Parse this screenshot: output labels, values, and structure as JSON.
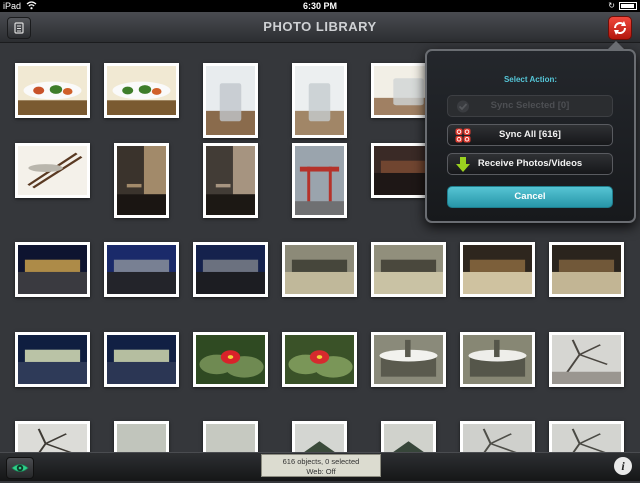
{
  "status_bar": {
    "device": "iPad",
    "time": "6:30 PM",
    "battery_level": 0.9
  },
  "nav": {
    "title": "PHOTO LIBRARY"
  },
  "popover": {
    "heading": "Select Action:",
    "sync_selected": "Sync Selected [0]",
    "sync_all": "Sync All [616]",
    "receive": "Receive Photos/Videos",
    "cancel": "Cancel"
  },
  "toolbar": {
    "status_line1": "616 objects, 0 selected",
    "status_line2": "Web: Off"
  },
  "icons": [
    "album-icon",
    "sync-icon",
    "checkmark-icon",
    "sync-arrows-icon",
    "download-arrow-icon",
    "eye-icon",
    "info-icon"
  ],
  "colors": {
    "accent": "#3bb0c2",
    "sync_red": "#e0281c",
    "heading_cyan": "#55c6d8"
  },
  "photos": [
    {
      "subject": "plate-dish",
      "colors": [
        "#f1e9d3",
        "#7a5a31",
        "#c8522a"
      ]
    },
    {
      "subject": "plate-dish",
      "colors": [
        "#f1e9d3",
        "#7a5a31",
        "#3e7d2a"
      ]
    },
    {
      "subject": "glass",
      "colors": [
        "#e8ecee",
        "#8a6b4c",
        "#c0c7cc"
      ]
    },
    {
      "subject": "glass",
      "colors": [
        "#eceff0",
        "#a18667",
        "#c6ccd0"
      ]
    },
    {
      "subject": "glass",
      "colors": [
        "#f2efe6",
        "#a08063",
        "#d0d4d6"
      ]
    },
    {
      "subject": "chopsticks",
      "colors": [
        "#f4f1ea",
        "#5a3a23",
        "#b9b6ad"
      ]
    },
    {
      "subject": "interior",
      "colors": [
        "#3a332c",
        "#1a1512",
        "#a28a6a"
      ]
    },
    {
      "subject": "interior",
      "colors": [
        "#423c36",
        "#1c1814",
        "#a69480"
      ]
    },
    {
      "subject": "torii-building",
      "colors": [
        "#9aa4ad",
        "#b5322a",
        "#6f7072"
      ]
    },
    {
      "subject": "night-street",
      "colors": [
        "#3a2a26",
        "#7a4a32",
        "#1e1716"
      ]
    },
    {
      "subject": "night-city",
      "colors": [
        "#0e1430",
        "#c9a04c",
        "#3a3a40"
      ]
    },
    {
      "subject": "night-city",
      "colors": [
        "#1a2a6a",
        "#8a8f9a",
        "#23242a"
      ]
    },
    {
      "subject": "night-city",
      "colors": [
        "#15224d",
        "#7a7f88",
        "#1c1d22"
      ]
    },
    {
      "subject": "plaza-night",
      "colors": [
        "#8c8a78",
        "#3a3a30",
        "#c0b89a"
      ]
    },
    {
      "subject": "plaza-night",
      "colors": [
        "#918f7c",
        "#3d3c33",
        "#c9c2a4"
      ]
    },
    {
      "subject": "night-traffic",
      "colors": [
        "#2e261e",
        "#8a6a40",
        "#cfc2a0"
      ]
    },
    {
      "subject": "night-traffic",
      "colors": [
        "#2a241d",
        "#7e623e",
        "#c2b594"
      ]
    },
    {
      "subject": "stadium-lights",
      "colors": [
        "#0f1e40",
        "#d8e0b8",
        "#2e3a58"
      ]
    },
    {
      "subject": "stadium-lights",
      "colors": [
        "#112044",
        "#d2dab0",
        "#2b3654"
      ]
    },
    {
      "subject": "red-flower",
      "colors": [
        "#2f4a22",
        "#d8222a",
        "#6f8a52"
      ]
    },
    {
      "subject": "red-flower",
      "colors": [
        "#3a5228",
        "#d62a2e",
        "#7a9658"
      ]
    },
    {
      "subject": "snow-planter",
      "colors": [
        "#5a5a4e",
        "#f2f2ee",
        "#8a8a7a"
      ]
    },
    {
      "subject": "snow-planter",
      "colors": [
        "#55564a",
        "#eeeeea",
        "#878774"
      ]
    },
    {
      "subject": "snow-branch",
      "colors": [
        "#d6d6d2",
        "#4a4640",
        "#9a9690"
      ]
    },
    {
      "subject": "snow-branch",
      "colors": [
        "#dcdcd8",
        "#3e3a34",
        "#a29e96"
      ]
    },
    {
      "subject": "bright-sky",
      "colors": [
        "#e8eae6",
        "#c6c9c2",
        "#9aa092"
      ]
    },
    {
      "subject": "bright-sky",
      "colors": [
        "#ececea",
        "#cacdc6",
        "#a0a598"
      ]
    },
    {
      "subject": "temple",
      "colors": [
        "#d4d6d2",
        "#3a4a3a",
        "#5a5a52"
      ]
    },
    {
      "subject": "temple",
      "colors": [
        "#d0d2cc",
        "#37463a",
        "#565650"
      ]
    },
    {
      "subject": "trees-building",
      "colors": [
        "#cfd0cc",
        "#4e4e48",
        "#8e8e86"
      ]
    },
    {
      "subject": "trees-building",
      "colors": [
        "#d3d4d0",
        "#4a4a44",
        "#94948c"
      ]
    }
  ]
}
